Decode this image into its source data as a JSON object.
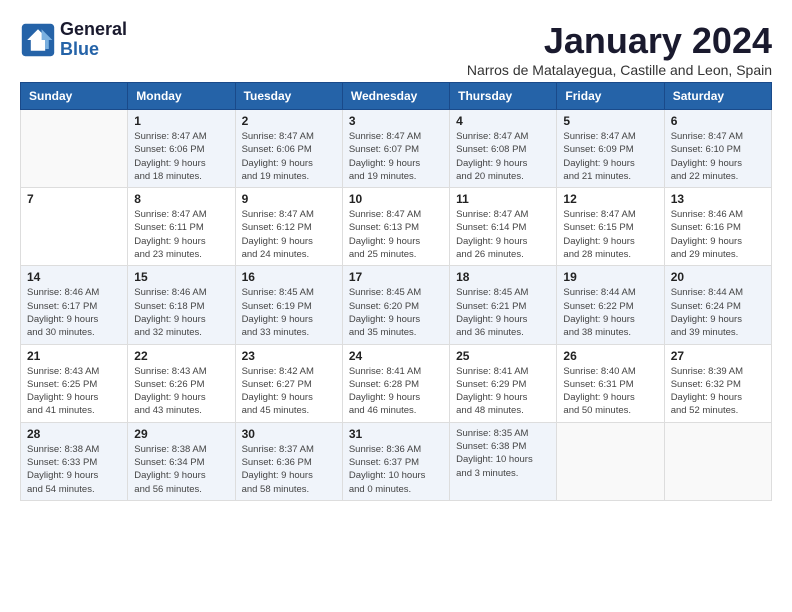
{
  "logo": {
    "line1": "General",
    "line2": "Blue"
  },
  "title": "January 2024",
  "subtitle": "Narros de Matalayegua, Castille and Leon, Spain",
  "weekdays": [
    "Sunday",
    "Monday",
    "Tuesday",
    "Wednesday",
    "Thursday",
    "Friday",
    "Saturday"
  ],
  "weeks": [
    [
      {
        "day": "",
        "info": ""
      },
      {
        "day": "1",
        "info": "Sunrise: 8:47 AM\nSunset: 6:06 PM\nDaylight: 9 hours\nand 18 minutes."
      },
      {
        "day": "2",
        "info": "Sunrise: 8:47 AM\nSunset: 6:06 PM\nDaylight: 9 hours\nand 19 minutes."
      },
      {
        "day": "3",
        "info": "Sunrise: 8:47 AM\nSunset: 6:07 PM\nDaylight: 9 hours\nand 19 minutes."
      },
      {
        "day": "4",
        "info": "Sunrise: 8:47 AM\nSunset: 6:08 PM\nDaylight: 9 hours\nand 20 minutes."
      },
      {
        "day": "5",
        "info": "Sunrise: 8:47 AM\nSunset: 6:09 PM\nDaylight: 9 hours\nand 21 minutes."
      },
      {
        "day": "6",
        "info": "Sunrise: 8:47 AM\nSunset: 6:10 PM\nDaylight: 9 hours\nand 22 minutes."
      }
    ],
    [
      {
        "day": "7",
        "info": ""
      },
      {
        "day": "8",
        "info": "Sunrise: 8:47 AM\nSunset: 6:11 PM\nDaylight: 9 hours\nand 23 minutes."
      },
      {
        "day": "9",
        "info": "Sunrise: 8:47 AM\nSunset: 6:12 PM\nDaylight: 9 hours\nand 24 minutes."
      },
      {
        "day": "10",
        "info": "Sunrise: 8:47 AM\nSunset: 6:13 PM\nDaylight: 9 hours\nand 25 minutes."
      },
      {
        "day": "11",
        "info": "Sunrise: 8:47 AM\nSunset: 6:14 PM\nDaylight: 9 hours\nand 26 minutes."
      },
      {
        "day": "12",
        "info": "Sunrise: 8:47 AM\nSunset: 6:15 PM\nDaylight: 9 hours\nand 28 minutes."
      },
      {
        "day": "13",
        "info": "Sunrise: 8:46 AM\nSunset: 6:16 PM\nDaylight: 9 hours\nand 29 minutes."
      }
    ],
    [
      {
        "day": "14",
        "info": "Sunrise: 8:46 AM\nSunset: 6:17 PM\nDaylight: 9 hours\nand 30 minutes."
      },
      {
        "day": "15",
        "info": "Sunrise: 8:46 AM\nSunset: 6:18 PM\nDaylight: 9 hours\nand 32 minutes."
      },
      {
        "day": "16",
        "info": "Sunrise: 8:45 AM\nSunset: 6:19 PM\nDaylight: 9 hours\nand 33 minutes."
      },
      {
        "day": "17",
        "info": "Sunrise: 8:45 AM\nSunset: 6:20 PM\nDaylight: 9 hours\nand 35 minutes."
      },
      {
        "day": "18",
        "info": "Sunrise: 8:45 AM\nSunset: 6:21 PM\nDaylight: 9 hours\nand 36 minutes."
      },
      {
        "day": "19",
        "info": "Sunrise: 8:44 AM\nSunset: 6:22 PM\nDaylight: 9 hours\nand 38 minutes."
      },
      {
        "day": "20",
        "info": "Sunrise: 8:44 AM\nSunset: 6:24 PM\nDaylight: 9 hours\nand 39 minutes."
      }
    ],
    [
      {
        "day": "21",
        "info": "Sunrise: 8:43 AM\nSunset: 6:25 PM\nDaylight: 9 hours\nand 41 minutes."
      },
      {
        "day": "22",
        "info": "Sunrise: 8:43 AM\nSunset: 6:26 PM\nDaylight: 9 hours\nand 43 minutes."
      },
      {
        "day": "23",
        "info": "Sunrise: 8:42 AM\nSunset: 6:27 PM\nDaylight: 9 hours\nand 45 minutes."
      },
      {
        "day": "24",
        "info": "Sunrise: 8:41 AM\nSunset: 6:28 PM\nDaylight: 9 hours\nand 46 minutes."
      },
      {
        "day": "25",
        "info": "Sunrise: 8:41 AM\nSunset: 6:29 PM\nDaylight: 9 hours\nand 48 minutes."
      },
      {
        "day": "26",
        "info": "Sunrise: 8:40 AM\nSunset: 6:31 PM\nDaylight: 9 hours\nand 50 minutes."
      },
      {
        "day": "27",
        "info": "Sunrise: 8:39 AM\nSunset: 6:32 PM\nDaylight: 9 hours\nand 52 minutes."
      }
    ],
    [
      {
        "day": "28",
        "info": "Sunrise: 8:38 AM\nSunset: 6:33 PM\nDaylight: 9 hours\nand 54 minutes."
      },
      {
        "day": "29",
        "info": "Sunrise: 8:38 AM\nSunset: 6:34 PM\nDaylight: 9 hours\nand 56 minutes."
      },
      {
        "day": "30",
        "info": "Sunrise: 8:37 AM\nSunset: 6:36 PM\nDaylight: 9 hours\nand 58 minutes."
      },
      {
        "day": "31",
        "info": "Sunrise: 8:36 AM\nSunset: 6:37 PM\nDaylight: 10 hours\nand 0 minutes."
      },
      {
        "day": "",
        "info": "Sunrise: 8:35 AM\nSunset: 6:38 PM\nDaylight: 10 hours\nand 3 minutes."
      },
      {
        "day": "",
        "info": ""
      },
      {
        "day": "",
        "info": ""
      }
    ]
  ]
}
